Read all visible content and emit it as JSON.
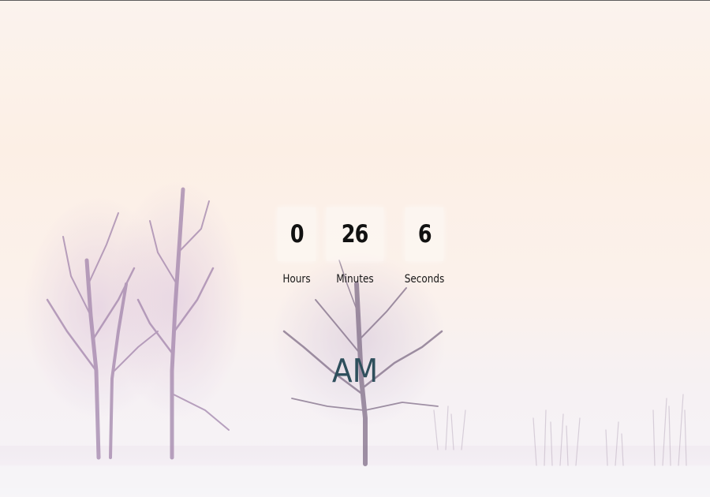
{
  "countdown": {
    "hours": {
      "value": "0",
      "label": "Hours"
    },
    "minutes": {
      "value": "26",
      "label": "Minutes"
    },
    "seconds": {
      "value": "6",
      "label": "Seconds"
    }
  },
  "meridiem": "AM",
  "colors": {
    "sky": "#fcece0",
    "snow": "#f3f0f5",
    "tree": "#9a79a6",
    "meridiem_text": "#2e4f5c",
    "digit_text": "#111111"
  }
}
